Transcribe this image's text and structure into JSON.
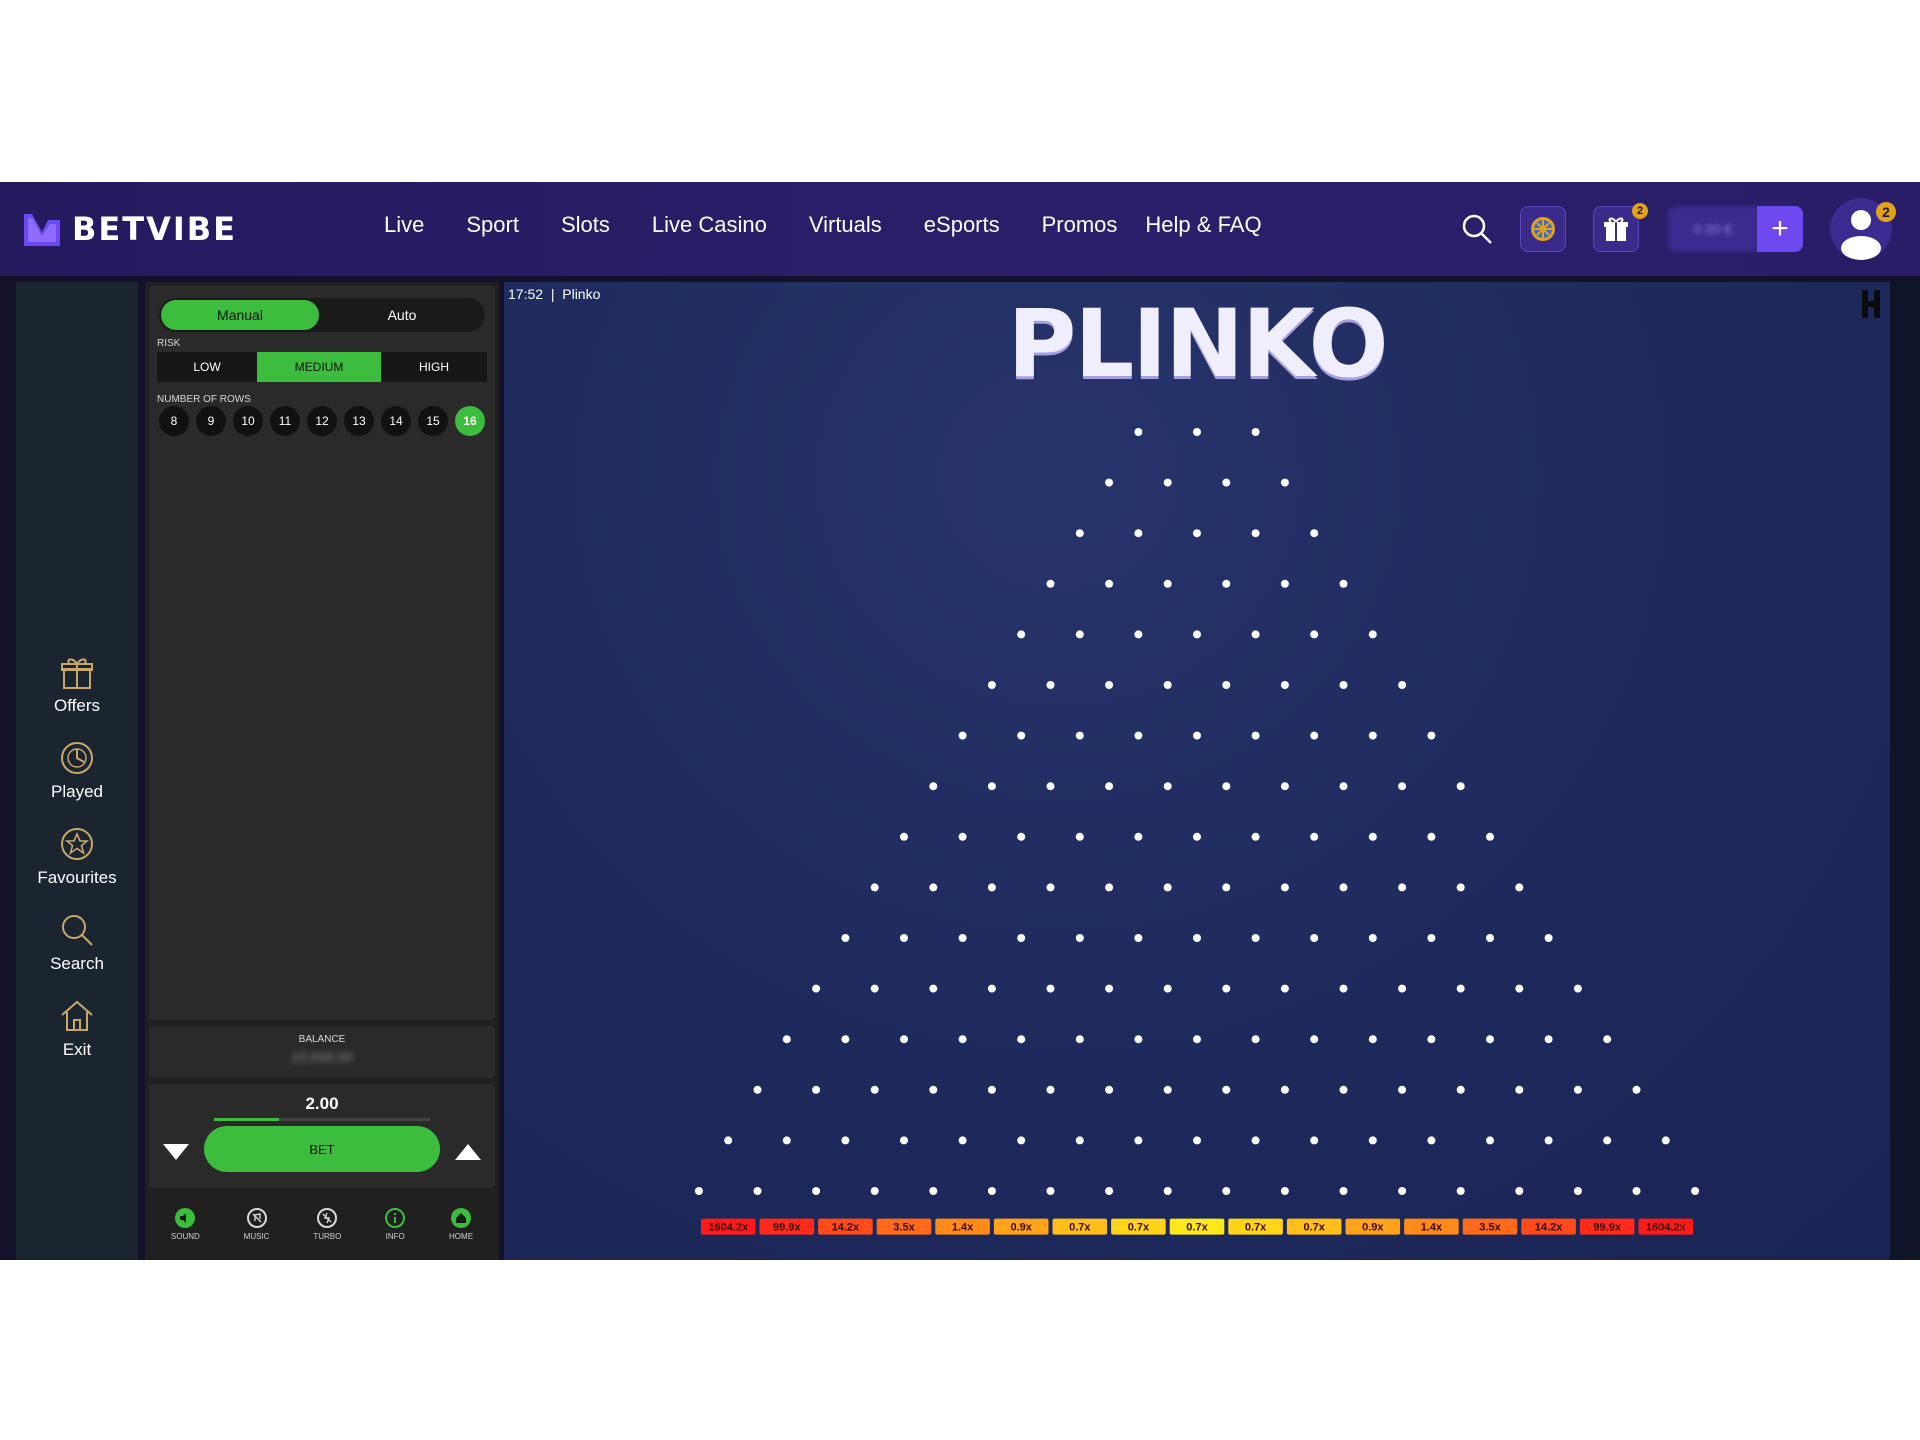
{
  "header": {
    "brand": "BETVIBE",
    "nav": [
      "Live",
      "Sport",
      "Slots",
      "Live Casino",
      "Virtuals",
      "eSports",
      "Promos",
      "Help & FAQ"
    ],
    "gift_badge": "2",
    "avatar_badge": "2",
    "deposit_label": "+",
    "icons": {
      "search": "search-icon",
      "wheel": "wheel-icon",
      "gift": "gift-icon",
      "avatar": "user-icon"
    }
  },
  "rail": {
    "items": [
      {
        "label": "Offers",
        "icon": "gift-icon"
      },
      {
        "label": "Played",
        "icon": "history-icon"
      },
      {
        "label": "Favourites",
        "icon": "star-icon"
      },
      {
        "label": "Search",
        "icon": "search-icon"
      },
      {
        "label": "Exit",
        "icon": "home-icon"
      }
    ]
  },
  "controls": {
    "modes": [
      "Manual",
      "Auto"
    ],
    "active_mode": "Manual",
    "risk_label": "RISK",
    "risk_options": [
      "LOW",
      "MEDIUM",
      "HIGH"
    ],
    "active_risk": "MEDIUM",
    "rows_label": "NUMBER OF ROWS",
    "rows_options": [
      "8",
      "9",
      "10",
      "11",
      "12",
      "13",
      "14",
      "15",
      "16"
    ],
    "active_rows": "16",
    "balance_label": "BALANCE",
    "balance_value": "10,000.00",
    "bet_amount": "2.00",
    "bet_slider_fraction": 0.3,
    "bet_label": "BET",
    "footer": [
      {
        "label": "SOUND",
        "icon": "sound-icon"
      },
      {
        "label": "MUSIC",
        "icon": "music-icon"
      },
      {
        "label": "TURBO",
        "icon": "turbo-icon"
      },
      {
        "label": "INFO",
        "icon": "info-icon"
      },
      {
        "label": "HOME",
        "icon": "home-icon"
      }
    ]
  },
  "game": {
    "time": "17:52",
    "name": "Plinko",
    "title": "PLINKO",
    "peg_rows": 16,
    "multipliers": [
      "1604.2x",
      "99.9x",
      "14.2x",
      "3.5x",
      "1.4x",
      "0.9x",
      "0.7x",
      "0.7x",
      "0.7x",
      "0.7x",
      "0.7x",
      "0.9x",
      "1.4x",
      "3.5x",
      "14.2x",
      "99.9x",
      "1604.2x"
    ],
    "multiplier_colors": [
      "#ff1a1a",
      "#ff2a1a",
      "#ff4a1a",
      "#ff6a1a",
      "#ff8a1a",
      "#ffa41a",
      "#ffbe1a",
      "#ffd41a",
      "#ffe81a",
      "#ffd41a",
      "#ffbe1a",
      "#ffa41a",
      "#ff8a1a",
      "#ff6a1a",
      "#ff4a1a",
      "#ff2a1a",
      "#ff1a1a"
    ]
  },
  "colors": {
    "accent_green": "#3dbd3d",
    "header_bg": "#2b1f6b",
    "deposit_purple": "#6d4af0"
  }
}
